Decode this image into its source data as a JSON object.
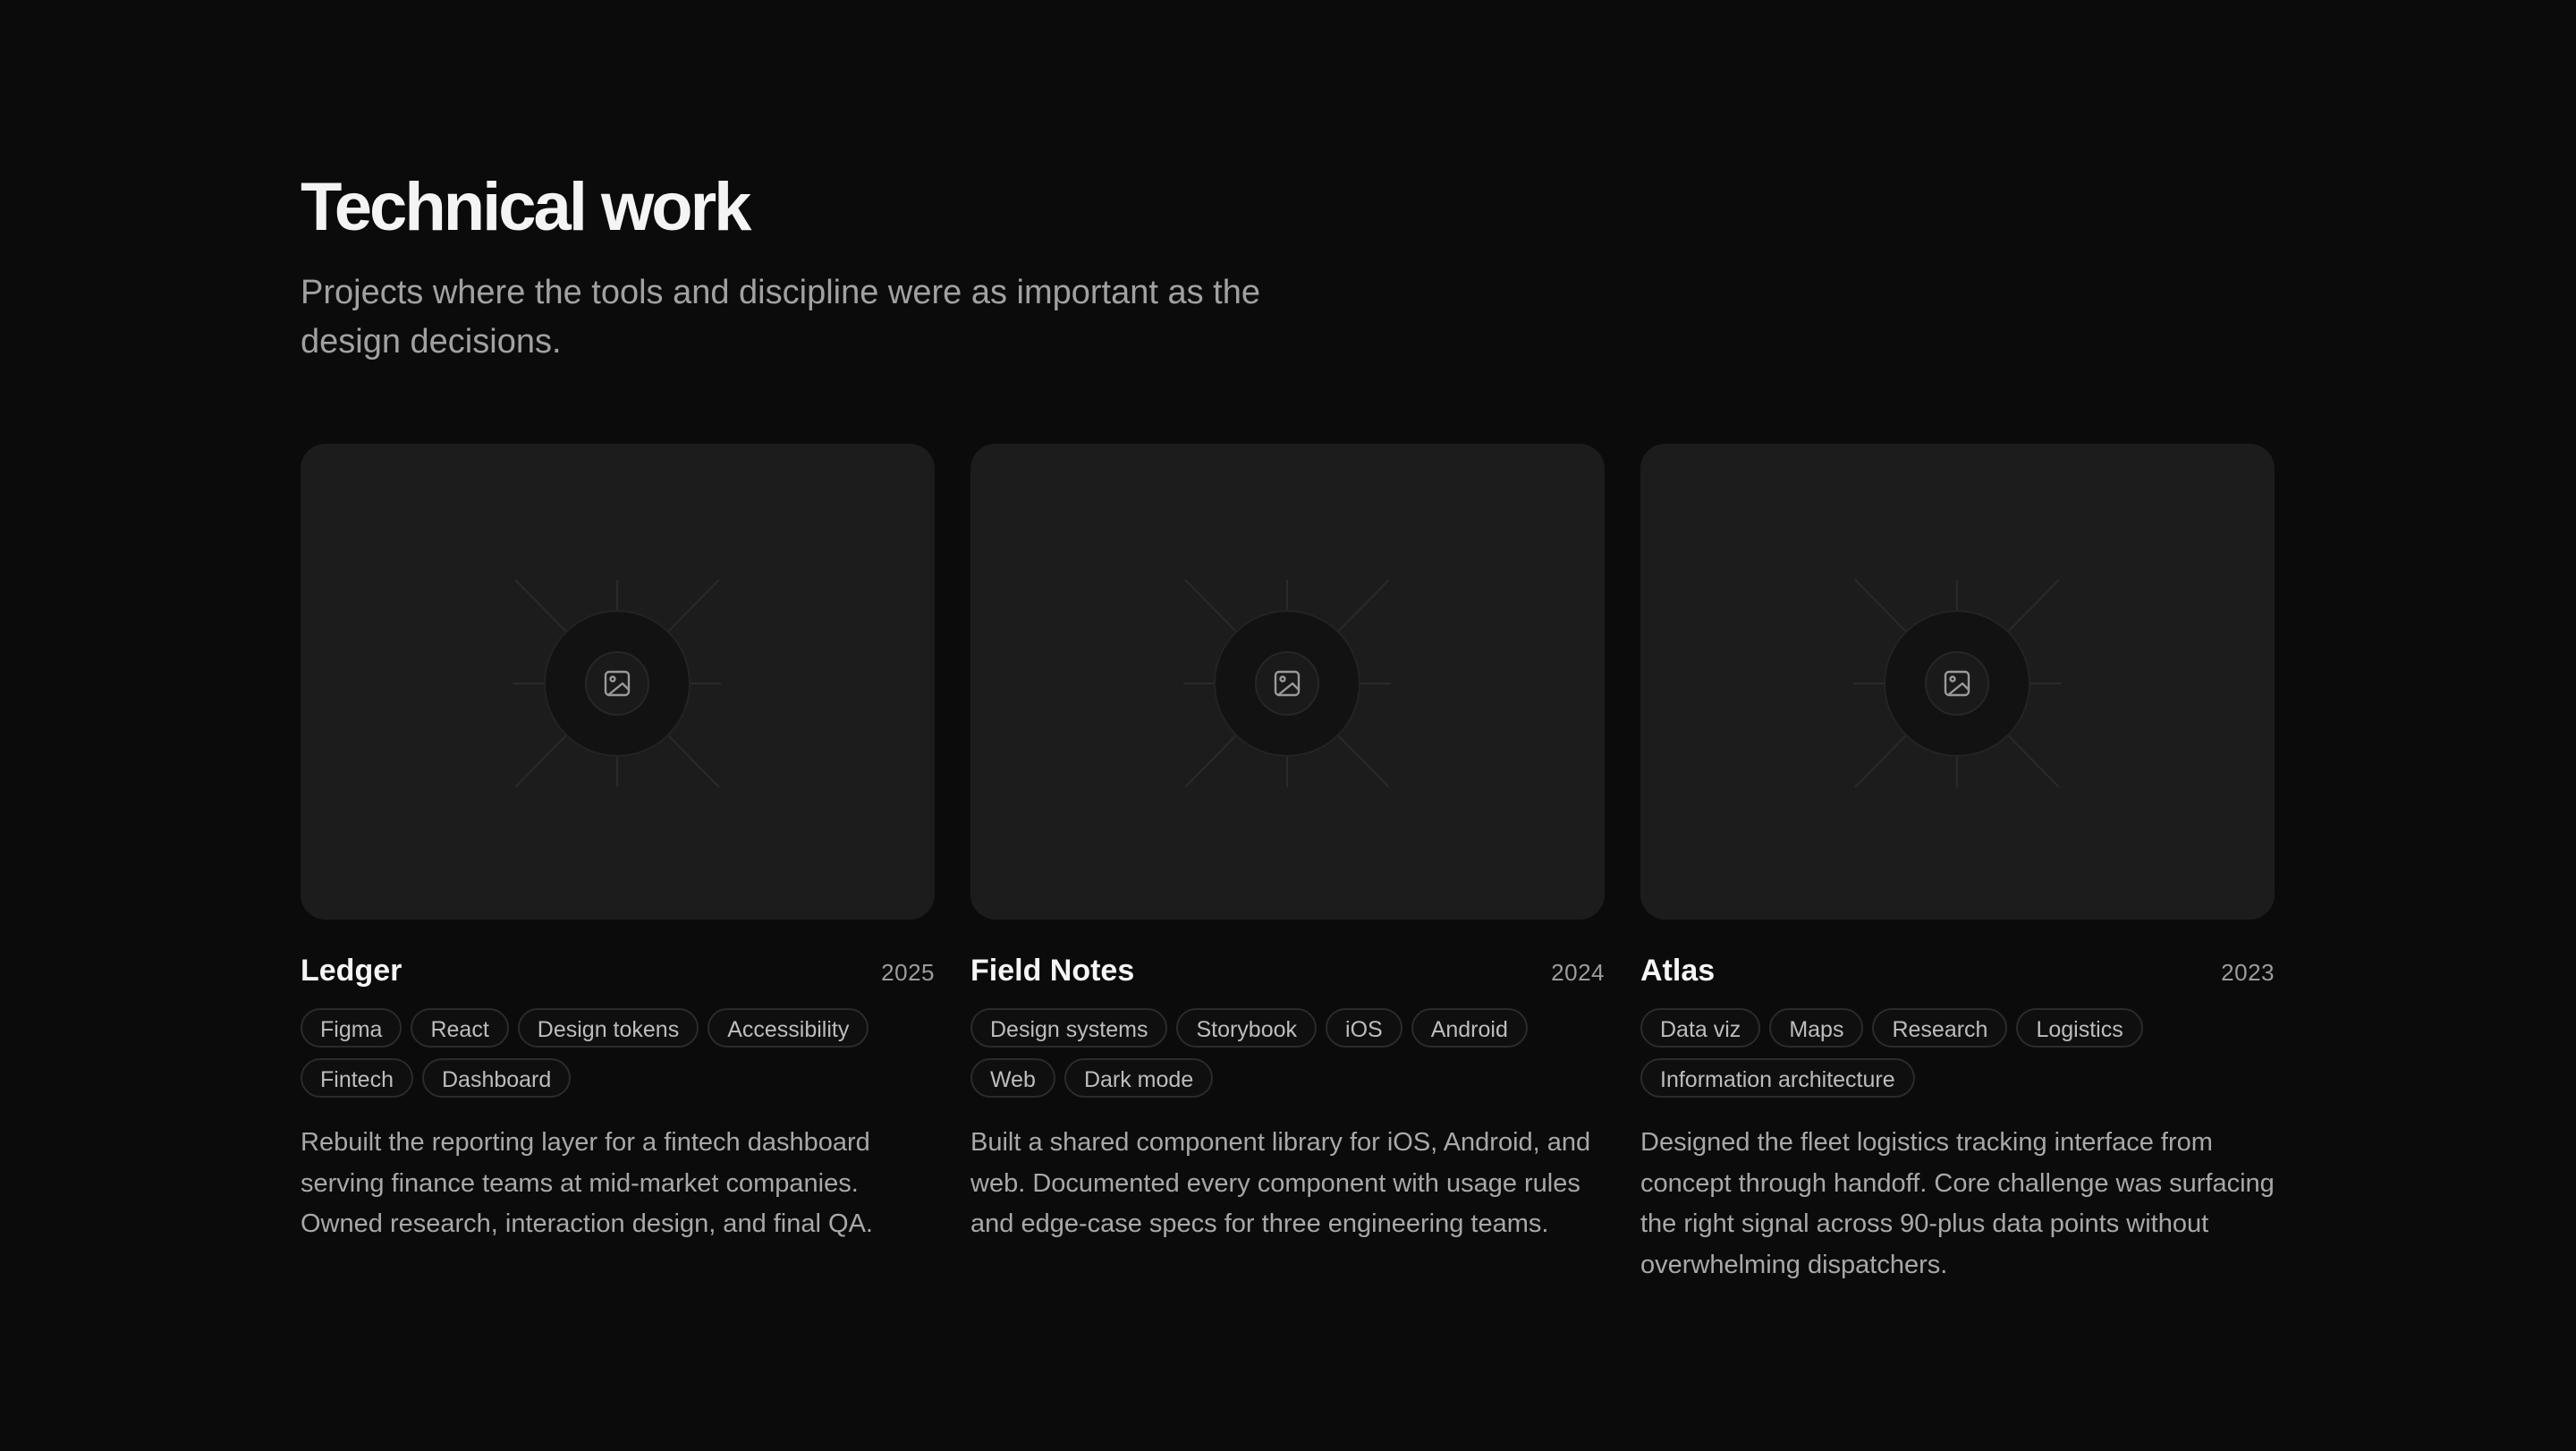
{
  "section": {
    "title": "Technical work",
    "subtitle": "Projects where the tools and discipline were as important as the design decisions."
  },
  "colors": {
    "background": "#0b0b0b",
    "card": "#1c1c1c",
    "text_primary": "#f4f4f4",
    "text_muted": "#a1a1a1"
  },
  "projects": [
    {
      "title": "Ledger",
      "year": "2025",
      "image_icon": "image-placeholder-icon",
      "tags": [
        "Figma",
        "React",
        "Design tokens",
        "Accessibility",
        "Fintech",
        "Dashboard"
      ],
      "description": "Rebuilt the reporting layer for a fintech dashboard serving finance teams at mid-market companies. Owned research, interaction design, and final QA."
    },
    {
      "title": "Field Notes",
      "year": "2024",
      "image_icon": "image-placeholder-icon",
      "tags": [
        "Design systems",
        "Storybook",
        "iOS",
        "Android",
        "Web",
        "Dark mode"
      ],
      "description": "Built a shared component library for iOS, Android, and web. Documented every component with usage rules and edge-case specs for three engineering teams."
    },
    {
      "title": "Atlas",
      "year": "2023",
      "image_icon": "image-placeholder-icon",
      "tags": [
        "Data viz",
        "Maps",
        "Research",
        "Logistics",
        "Information architecture"
      ],
      "description": "Designed the fleet logistics tracking interface from concept through handoff. Core challenge was surfacing the right signal across 90-plus data points without overwhelming dispatchers."
    }
  ]
}
